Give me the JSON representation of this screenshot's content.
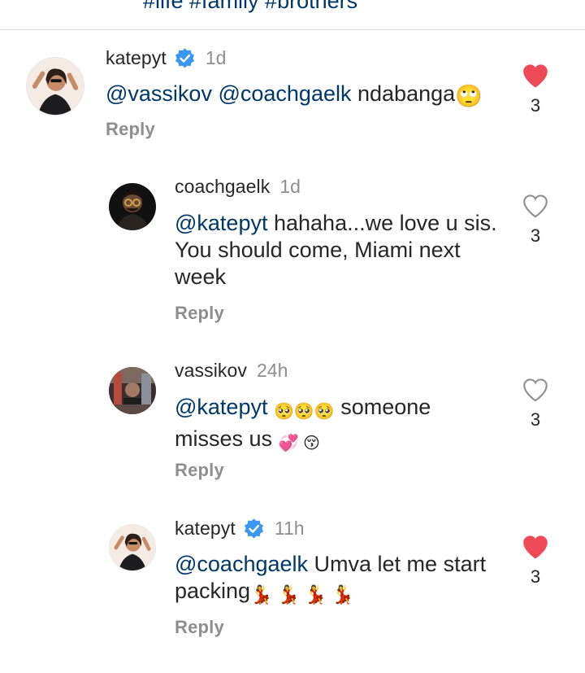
{
  "caption_fragment": "#life #family #brothers",
  "colors": {
    "heart_liked": "#ed4956",
    "mention": "#00376b",
    "verified": "#3897f0",
    "muted": "#8e8e8e"
  },
  "comments": [
    {
      "username": "katepyt",
      "verified": true,
      "time": "1d",
      "mentions": [
        "@vassikov",
        "@coachgaelk"
      ],
      "text": "ndabanga",
      "emojis": "🙄",
      "reply_label": "Reply",
      "liked": true,
      "like_count": "3",
      "avatar": "woman-selfie-avatar"
    },
    {
      "username": "coachgaelk",
      "verified": false,
      "time": "1d",
      "mentions": [
        "@katepyt"
      ],
      "text_lines": [
        "hahaha...we love u sis.",
        "You should come, Miami next",
        "week"
      ],
      "reply_label": "Reply",
      "liked": false,
      "like_count": "3",
      "avatar": "man-sunglasses-avatar"
    },
    {
      "username": "vassikov",
      "verified": false,
      "time": "24h",
      "mentions": [
        "@katepyt"
      ],
      "text_line1": "someone",
      "text_line2": "misses us",
      "emojis_1": "🥺🥺🥺",
      "emojis_2": "💞 😚",
      "reply_label": "Reply",
      "liked": false,
      "like_count": "3",
      "avatar": "gym-avatar"
    },
    {
      "username": "katepyt",
      "verified": true,
      "time": "11h",
      "mentions": [
        "@coachgaelk"
      ],
      "text_line1": "Umva let me start",
      "text_line2": "packing",
      "emojis": "💃💃💃💃",
      "reply_label": "Reply",
      "liked": true,
      "like_count": "3",
      "avatar": "woman-selfie-avatar"
    }
  ]
}
